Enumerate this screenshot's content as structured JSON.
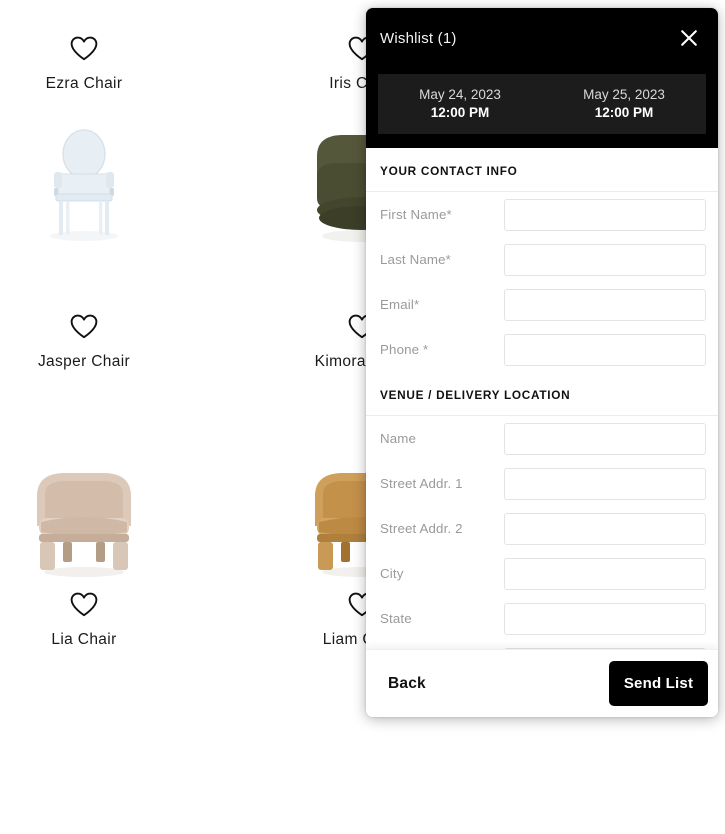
{
  "catalog": {
    "products": [
      {
        "name": "Ezra Chair",
        "favorite_icon": "heart-outline-icon",
        "image": "ghost-acrylic-armchair",
        "colors": {
          "body": "#dfe6ec",
          "accent": "#c9d5de"
        }
      },
      {
        "name": "Iris Chair",
        "favorite_icon": "heart-outline-icon",
        "image": "olive-barrel-armchair",
        "colors": {
          "body": "#4f5134",
          "accent": "#3d3f28"
        }
      },
      {
        "name": "Jasper Chair",
        "favorite_icon": "heart-outline-icon",
        "image": "",
        "colors": {
          "body": "",
          "accent": ""
        }
      },
      {
        "name": "Kimora Chair",
        "favorite_icon": "heart-outline-icon",
        "image": "",
        "colors": {
          "body": "",
          "accent": ""
        }
      },
      {
        "name": "Lia Chair",
        "favorite_icon": "heart-outline-icon",
        "image": "blush-barrel-armchair",
        "colors": {
          "body": "#dcc7b8",
          "accent": "#c3a894"
        }
      },
      {
        "name": "Liam Chair",
        "favorite_icon": "heart-outline-icon",
        "image": "camel-barrel-armchair",
        "colors": {
          "body": "#cc9b57",
          "accent": "#b5863f"
        }
      }
    ]
  },
  "panel": {
    "title": "Wishlist (1)",
    "close_icon": "close-x-icon",
    "dates": [
      {
        "date": "May 24, 2023",
        "time": "12:00 PM"
      },
      {
        "date": "May 25, 2023",
        "time": "12:00 PM"
      }
    ],
    "sections": [
      {
        "heading": "YOUR CONTACT INFO",
        "fields": [
          {
            "label": "First Name*",
            "value": "",
            "placeholder": ""
          },
          {
            "label": "Last Name*",
            "value": "",
            "placeholder": ""
          },
          {
            "label": "Email*",
            "value": "",
            "placeholder": ""
          },
          {
            "label": "Phone *",
            "value": "",
            "placeholder": ""
          }
        ]
      },
      {
        "heading": "VENUE / DELIVERY LOCATION",
        "fields": [
          {
            "label": "Name",
            "value": "",
            "placeholder": ""
          },
          {
            "label": "Street Addr. 1",
            "value": "",
            "placeholder": ""
          },
          {
            "label": "Street Addr. 2",
            "value": "",
            "placeholder": ""
          },
          {
            "label": "City",
            "value": "",
            "placeholder": ""
          },
          {
            "label": "State",
            "value": "",
            "placeholder": ""
          },
          {
            "label": "",
            "value": "",
            "placeholder": ""
          }
        ]
      }
    ],
    "footer": {
      "back_label": "Back",
      "send_label": "Send List"
    }
  },
  "colors": {
    "panel_header_bg": "#000000",
    "date_bar_bg": "#1c1c1c",
    "page_bg": "#ffffff",
    "label_gray": "#9a9a9a",
    "input_border": "#e3e3e3",
    "primary_button_bg": "#000000"
  }
}
